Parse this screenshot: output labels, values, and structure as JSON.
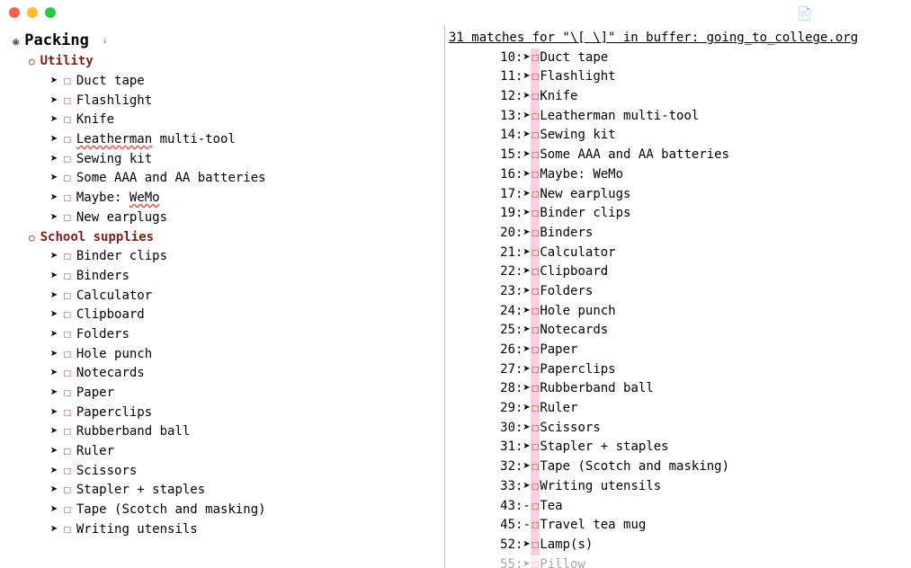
{
  "window": {
    "doc_icon": "📄"
  },
  "left": {
    "title": "Packing",
    "fold_glyph": "⇣",
    "radio_bullet": "◉",
    "open_bullet": "○",
    "arrow": "➤",
    "checkbox": "☐",
    "sections": [
      {
        "name": "Utility",
        "items": [
          {
            "text": "Duct tape"
          },
          {
            "text": "Flashlight"
          },
          {
            "text": "Knife"
          },
          {
            "text": "Leatherman multi-tool",
            "spell_word": "Leatherman"
          },
          {
            "text": "Sewing kit"
          },
          {
            "text": "Some AAA and AA batteries"
          },
          {
            "text": "Maybe: WeMo",
            "spell_word": "WeMo"
          },
          {
            "text": "New earplugs"
          }
        ]
      },
      {
        "name": "School supplies",
        "items": [
          {
            "text": "Binder clips"
          },
          {
            "text": "Binders"
          },
          {
            "text": "Calculator"
          },
          {
            "text": "Clipboard"
          },
          {
            "text": "Folders"
          },
          {
            "text": "Hole punch"
          },
          {
            "text": "Notecards"
          },
          {
            "text": "Paper"
          },
          {
            "text": "Paperclips"
          },
          {
            "text": "Rubberband ball"
          },
          {
            "text": "Ruler"
          },
          {
            "text": "Scissors"
          },
          {
            "text": "Stapler + staples"
          },
          {
            "text": "Tape (Scotch and masking)"
          },
          {
            "text": "Writing utensils"
          }
        ]
      }
    ]
  },
  "right": {
    "header": "31 matches for \"\\[ \\]\" in buffer: going_to_college.org",
    "arrow": "➤",
    "dash": "-",
    "checkbox": "☐",
    "lines": [
      {
        "ln": 10,
        "bullet": "arrow",
        "text": "Duct tape"
      },
      {
        "ln": 11,
        "bullet": "arrow",
        "text": "Flashlight"
      },
      {
        "ln": 12,
        "bullet": "arrow",
        "text": "Knife"
      },
      {
        "ln": 13,
        "bullet": "arrow",
        "text": "Leatherman multi-tool"
      },
      {
        "ln": 14,
        "bullet": "arrow",
        "text": "Sewing kit"
      },
      {
        "ln": 15,
        "bullet": "arrow",
        "text": "Some AAA and AA batteries"
      },
      {
        "ln": 16,
        "bullet": "arrow",
        "text": "Maybe: WeMo"
      },
      {
        "ln": 17,
        "bullet": "arrow",
        "text": "New earplugs"
      },
      {
        "ln": 19,
        "bullet": "arrow",
        "text": "Binder clips"
      },
      {
        "ln": 20,
        "bullet": "arrow",
        "text": "Binders"
      },
      {
        "ln": 21,
        "bullet": "arrow",
        "text": "Calculator"
      },
      {
        "ln": 22,
        "bullet": "arrow",
        "text": "Clipboard"
      },
      {
        "ln": 23,
        "bullet": "arrow",
        "text": "Folders"
      },
      {
        "ln": 24,
        "bullet": "arrow",
        "text": "Hole punch"
      },
      {
        "ln": 25,
        "bullet": "arrow",
        "text": "Notecards"
      },
      {
        "ln": 26,
        "bullet": "arrow",
        "text": "Paper"
      },
      {
        "ln": 27,
        "bullet": "arrow",
        "text": "Paperclips"
      },
      {
        "ln": 28,
        "bullet": "arrow",
        "text": "Rubberband ball"
      },
      {
        "ln": 29,
        "bullet": "arrow",
        "text": "Ruler"
      },
      {
        "ln": 30,
        "bullet": "arrow",
        "text": "Scissors"
      },
      {
        "ln": 31,
        "bullet": "arrow",
        "text": "Stapler + staples"
      },
      {
        "ln": 32,
        "bullet": "arrow",
        "text": "Tape (Scotch and masking)"
      },
      {
        "ln": 33,
        "bullet": "arrow",
        "text": "Writing utensils"
      },
      {
        "ln": 43,
        "bullet": "dash",
        "text": "Tea"
      },
      {
        "ln": 45,
        "bullet": "dash",
        "text": "Travel tea mug"
      },
      {
        "ln": 52,
        "bullet": "arrow",
        "text": "Lamp(s)"
      },
      {
        "ln": 55,
        "bullet": "arrow",
        "text": "Pillow",
        "cut": true
      }
    ]
  }
}
